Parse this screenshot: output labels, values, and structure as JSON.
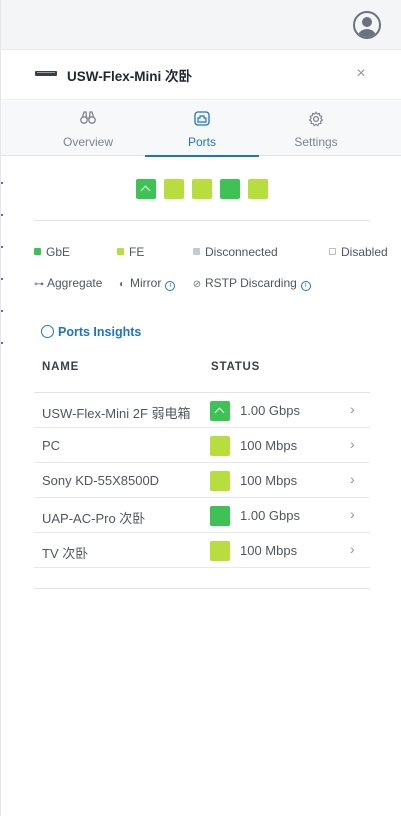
{
  "header": {
    "title": "USW-Flex-Mini 次卧",
    "close_glyph": "×"
  },
  "tabs": [
    {
      "label": "Overview",
      "icon": "binoculars-icon"
    },
    {
      "label": "Ports",
      "icon": "ports-icon",
      "active": true
    },
    {
      "label": "Settings",
      "icon": "gear-icon"
    }
  ],
  "ports": [
    {
      "type": "GbE",
      "uplink": true
    },
    {
      "type": "FE"
    },
    {
      "type": "FE"
    },
    {
      "type": "GbE"
    },
    {
      "type": "FE"
    }
  ],
  "legend": {
    "gbe": "GbE",
    "fe": "FE",
    "disconnected": "Disconnected",
    "disabled": "Disabled",
    "aggregate": "Aggregate",
    "mirror": "Mirror",
    "rstp": "RSTP Discarding"
  },
  "insights": {
    "label": "Ports Insights"
  },
  "table": {
    "columns": {
      "name": "NAME",
      "status": "STATUS"
    },
    "rows": [
      {
        "name": "USW-Flex-Mini 2F 弱电箱",
        "speed": "1.00 Gbps",
        "type": "GbE",
        "uplink": true
      },
      {
        "name": "PC",
        "speed": "100 Mbps",
        "type": "FE"
      },
      {
        "name": "Sony KD-55X8500D",
        "speed": "100 Mbps",
        "type": "FE"
      },
      {
        "name": "UAP-AC-Pro 次卧",
        "speed": "1.00 Gbps",
        "type": "GbE"
      },
      {
        "name": "TV 次卧",
        "speed": "100 Mbps",
        "type": "FE"
      }
    ]
  },
  "colors": {
    "accent": "#1d74c6",
    "gbe": "#3ec155",
    "fe": "#b7dd3f",
    "disconnected": "#c5c9d0"
  }
}
